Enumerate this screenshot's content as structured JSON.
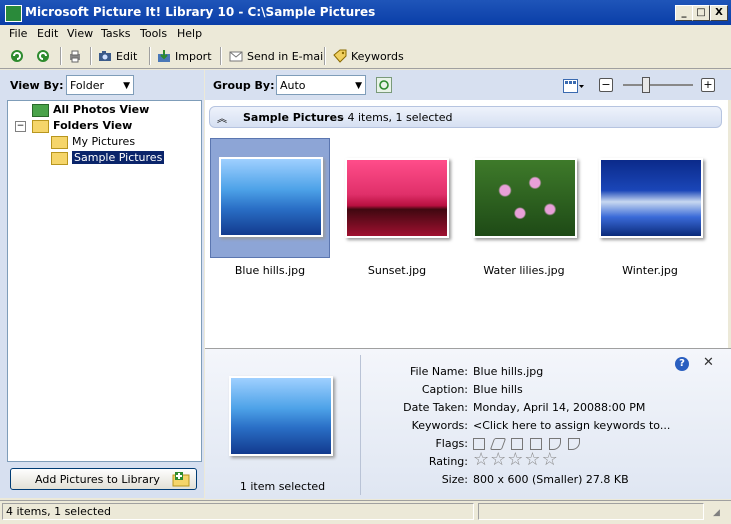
{
  "window": {
    "title": "Microsoft Picture It! Library 10 - C:\\Sample Pictures",
    "minimize": "_",
    "maximize": "□",
    "close": "X"
  },
  "menu": [
    "File",
    "Edit",
    "View",
    "Tasks",
    "Tools",
    "Help"
  ],
  "toolbar": {
    "edit_label": "Edit",
    "import_label": "Import",
    "email_label": "Send in E-mail",
    "keywords_label": "Keywords"
  },
  "left": {
    "view_by_label": "View By:",
    "view_by_value": "Folder",
    "tree": {
      "all_photos": "All Photos View",
      "folders_view": "Folders View",
      "my_pictures": "My Pictures",
      "sample_pictures": "Sample Pictures"
    },
    "add_button": "Add Pictures to Library"
  },
  "main": {
    "group_by_label": "Group By:",
    "group_by_value": "Auto",
    "group_title": "Sample Pictures",
    "group_count": " - 4 items, 1 selected",
    "thumbnails": [
      {
        "name": "Blue hills.jpg",
        "selected": true
      },
      {
        "name": "Sunset.jpg",
        "selected": false
      },
      {
        "name": "Water lilies.jpg",
        "selected": false
      },
      {
        "name": "Winter.jpg",
        "selected": false
      }
    ]
  },
  "details": {
    "selection_text": "1 item selected",
    "help": "?",
    "close": "✕",
    "file_name_label": "File Name:",
    "file_name": "Blue hills.jpg",
    "caption_label": "Caption:",
    "caption": "Blue hills",
    "date_label": "Date Taken:",
    "date": "Monday, April 14, 2008",
    "time": "8:00 PM",
    "keywords_label": "Keywords:",
    "keywords": "<Click here to assign keywords to...",
    "flags_label": "Flags:",
    "rating_label": "Rating:",
    "rating": 0,
    "size_label": "Size:",
    "size": "800 x 600 (Smaller) 27.8 KB"
  },
  "status": {
    "text": "4 items, 1 selected"
  },
  "colors": {
    "titlebar": "#0a3ea8",
    "selection": "#0a246a",
    "pane": "#d7e0f0"
  }
}
